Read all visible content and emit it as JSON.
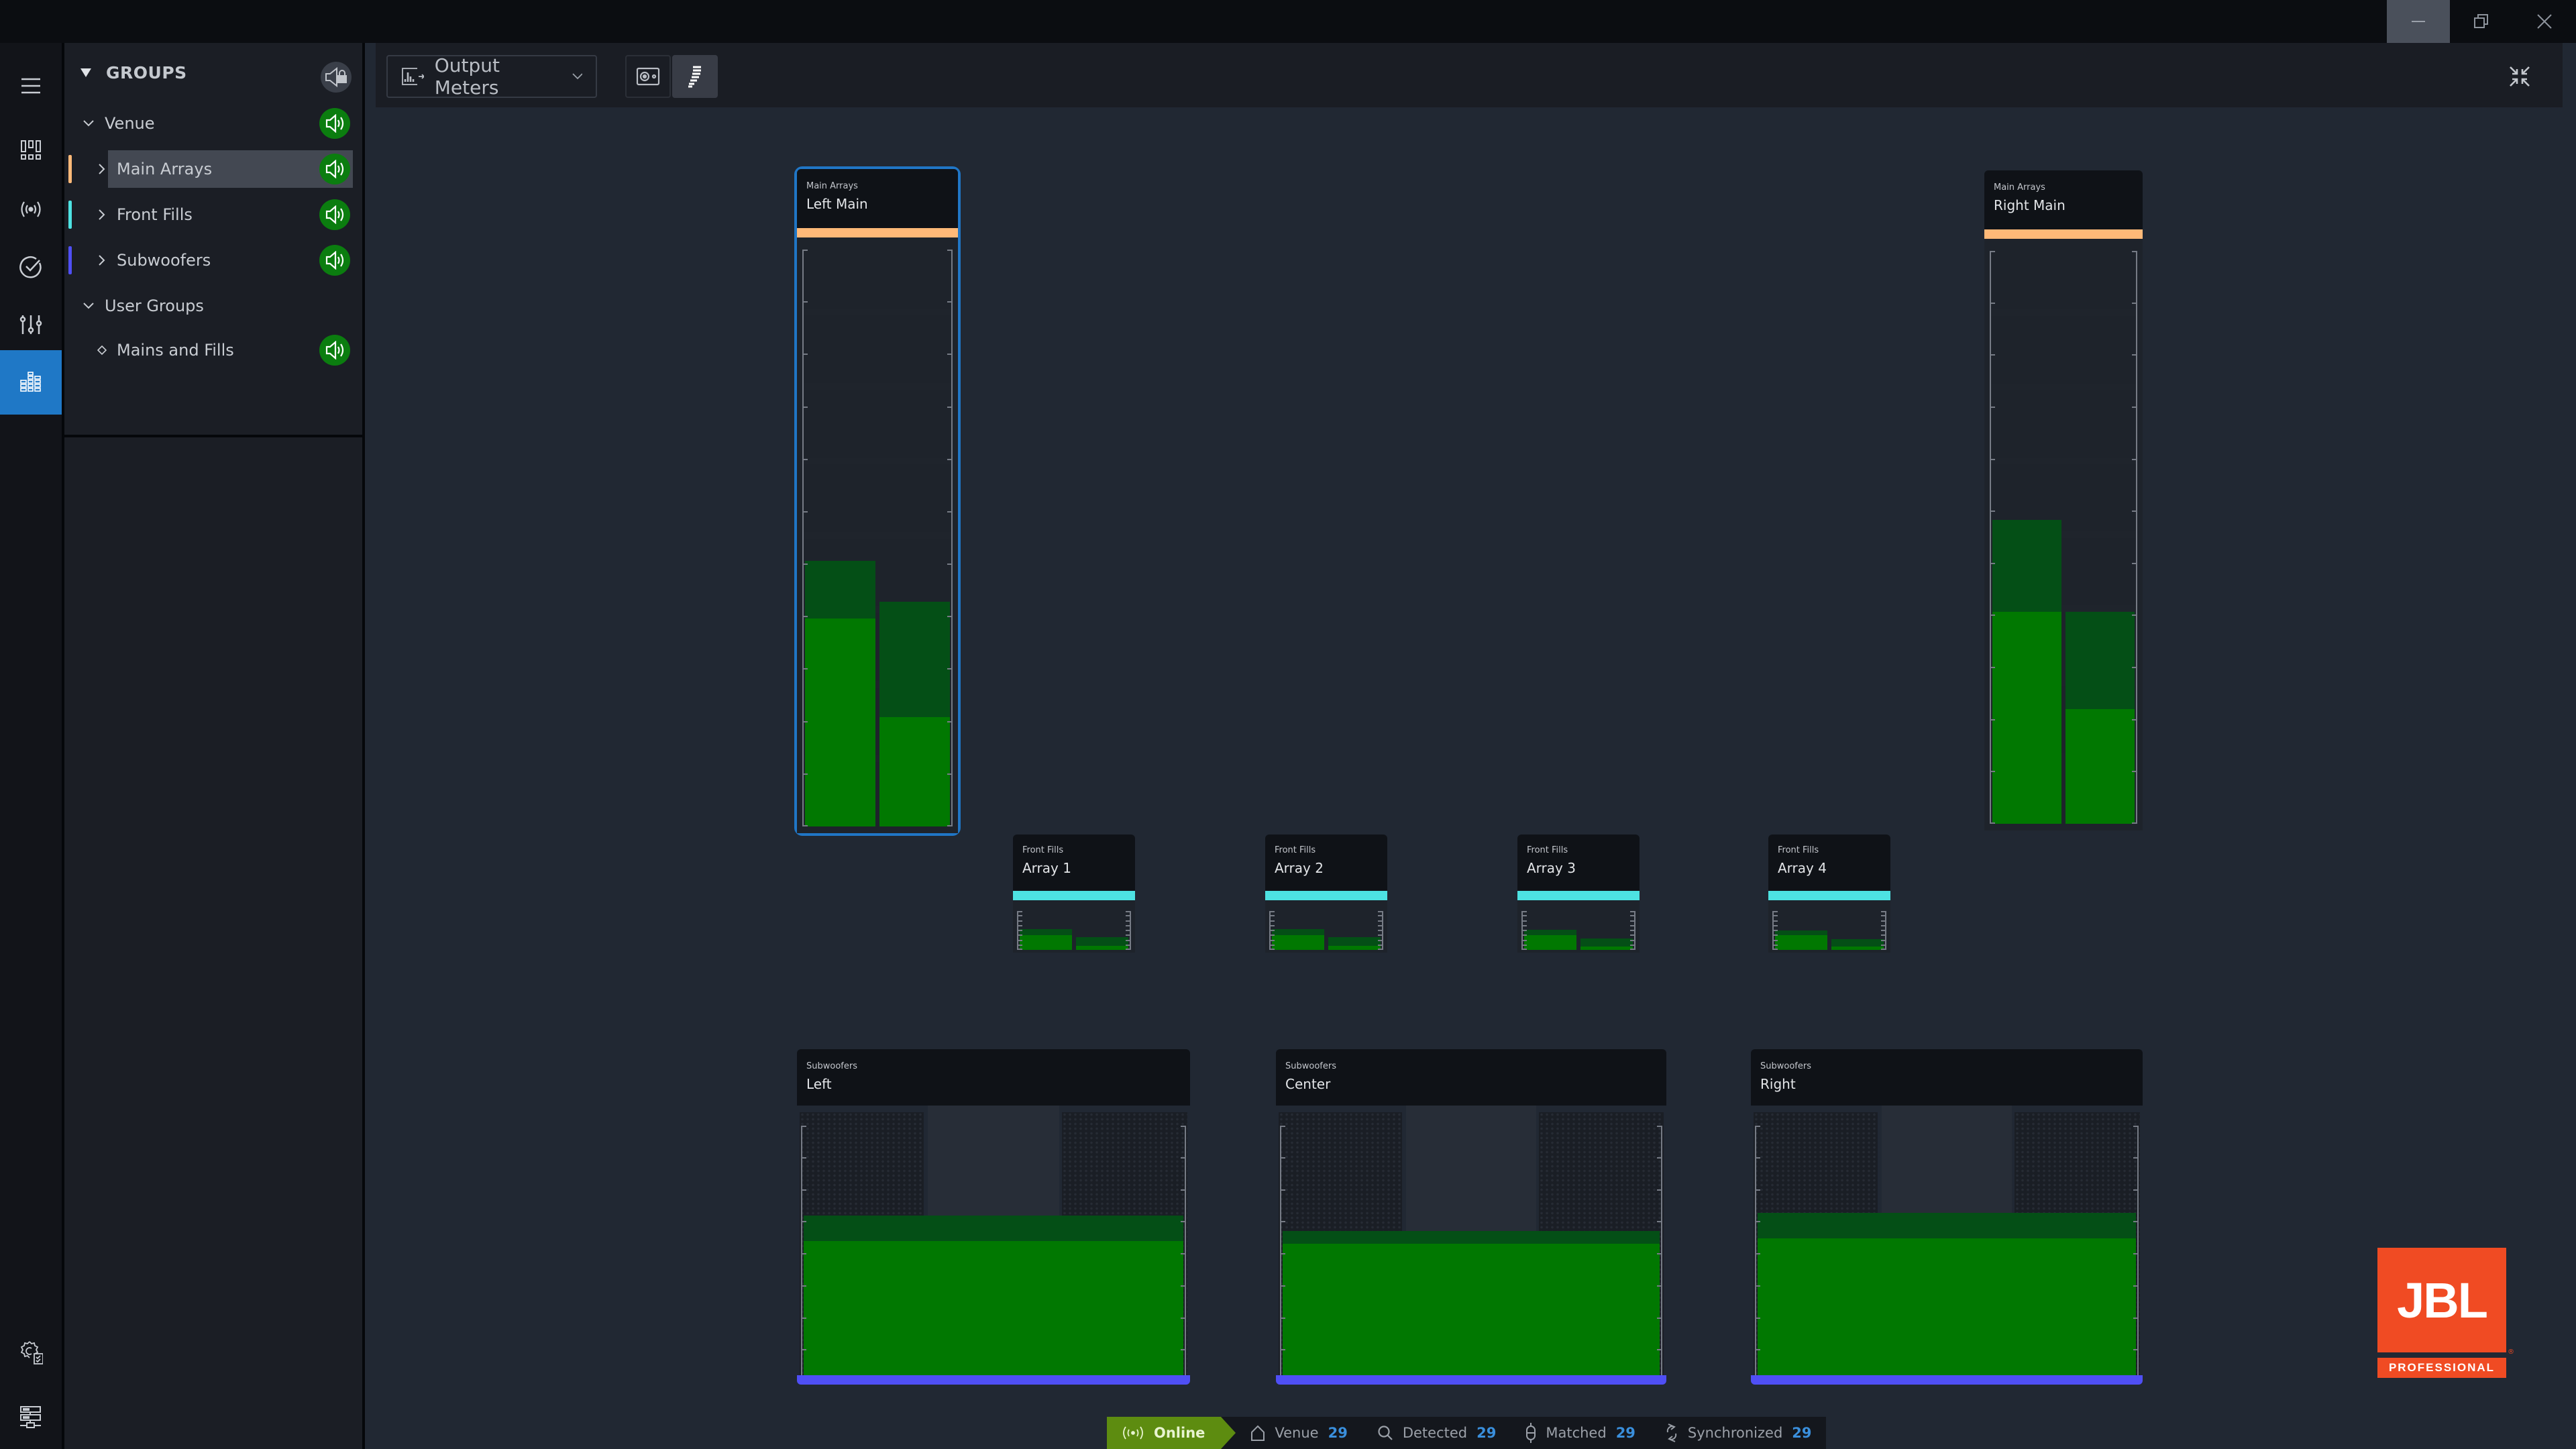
{
  "window": {
    "controls": {
      "minimize": "minimize",
      "restore": "restore",
      "close": "close"
    }
  },
  "rail": {
    "items": [
      {
        "name": "menu",
        "icon": "hamburger-icon",
        "active": false
      },
      {
        "name": "devices",
        "icon": "device-grid-icon",
        "active": false
      },
      {
        "name": "network",
        "icon": "broadcast-icon",
        "active": false
      },
      {
        "name": "check",
        "icon": "check-circle-icon",
        "active": false
      },
      {
        "name": "mixer",
        "icon": "sliders-icon",
        "active": false
      },
      {
        "name": "meters",
        "icon": "meter-bars-icon",
        "active": true
      },
      {
        "name": "settings",
        "icon": "gear-checklist-icon",
        "active": false
      },
      {
        "name": "server",
        "icon": "server-network-icon",
        "active": false
      }
    ]
  },
  "groups": {
    "title": "GROUPS",
    "lock_icon": "speaker-lock-icon",
    "items": [
      {
        "label": "Venue",
        "level": 0,
        "expander": "chevron-down",
        "has_mute": true,
        "color": null,
        "selected": false
      },
      {
        "label": "Main Arrays",
        "level": 1,
        "expander": "chevron-right",
        "has_mute": true,
        "color": "#ffb978",
        "selected": true
      },
      {
        "label": "Front Fills",
        "level": 1,
        "expander": "chevron-right",
        "has_mute": true,
        "color": "#4de2e2",
        "selected": false
      },
      {
        "label": "Subwoofers",
        "level": 1,
        "expander": "chevron-right",
        "has_mute": true,
        "color": "#4f4ff5",
        "selected": false
      },
      {
        "label": "User Groups",
        "level": 0,
        "expander": "chevron-down",
        "has_mute": false,
        "color": null,
        "selected": false
      },
      {
        "label": "Mains and Fills",
        "level": 1,
        "expander": "diamond",
        "has_mute": true,
        "color": null,
        "selected": false
      }
    ]
  },
  "toolbar": {
    "view_select": "Output Meters",
    "view_icon": "meter-output-icon",
    "buttons": [
      {
        "name": "speaker-view",
        "icon": "speaker-box-icon",
        "active": false
      },
      {
        "name": "array-view",
        "icon": "array-curve-icon",
        "active": true
      }
    ],
    "collapse_icon": "collapse-arrows-icon"
  },
  "colors": {
    "main_arrays": "#ffb978",
    "front_fills": "#4de2e2",
    "subwoofers": "#4f4ff5",
    "meter_rms": "#017801",
    "meter_peak": "#044f16",
    "selection": "#2076c6",
    "mute_on": "#0b7d0f",
    "online": "#5d8c10",
    "count": "#3a8fdc",
    "brand": "#f04b23"
  },
  "speakers": {
    "main": [
      {
        "group": "Main Arrays",
        "name": "Left Main",
        "selected": true,
        "segments": 8,
        "levels": [
          {
            "rms": 0.36,
            "peak": 0.46
          },
          {
            "rms": 0.19,
            "peak": 0.39
          }
        ]
      },
      {
        "group": "Main Arrays",
        "name": "Right Main",
        "selected": false,
        "segments": 8,
        "levels": [
          {
            "rms": 0.37,
            "peak": 0.53
          },
          {
            "rms": 0.2,
            "peak": 0.37
          }
        ]
      }
    ],
    "fills": [
      {
        "group": "Front Fills",
        "name": "Array 1",
        "levels": [
          {
            "rms": 0.38,
            "peak": 0.53
          },
          {
            "rms": 0.1,
            "peak": 0.32
          }
        ]
      },
      {
        "group": "Front Fills",
        "name": "Array 2",
        "levels": [
          {
            "rms": 0.38,
            "peak": 0.53
          },
          {
            "rms": 0.1,
            "peak": 0.32
          }
        ]
      },
      {
        "group": "Front Fills",
        "name": "Array 3",
        "levels": [
          {
            "rms": 0.38,
            "peak": 0.52
          },
          {
            "rms": 0.09,
            "peak": 0.29
          }
        ]
      },
      {
        "group": "Front Fills",
        "name": "Array 4",
        "levels": [
          {
            "rms": 0.38,
            "peak": 0.5
          },
          {
            "rms": 0.09,
            "peak": 0.27
          }
        ]
      }
    ],
    "subs": [
      {
        "group": "Subwoofers",
        "name": "Left",
        "levels": [
          {
            "rms": 0.55,
            "peak": 0.65
          }
        ]
      },
      {
        "group": "Subwoofers",
        "name": "Center",
        "levels": [
          {
            "rms": 0.54,
            "peak": 0.59
          }
        ]
      },
      {
        "group": "Subwoofers",
        "name": "Right",
        "levels": [
          {
            "rms": 0.56,
            "peak": 0.66
          }
        ]
      }
    ]
  },
  "status": {
    "online": "Online",
    "items": [
      {
        "label": "Venue",
        "value": "29",
        "icon": "home-icon"
      },
      {
        "label": "Detected",
        "value": "29",
        "icon": "search-icon"
      },
      {
        "label": "Matched",
        "value": "29",
        "icon": "match-icon"
      },
      {
        "label": "Synchronized",
        "value": "29",
        "icon": "sync-icon"
      }
    ]
  },
  "brand": {
    "logo_text": "JBL",
    "logo_sub": "PROFESSIONAL"
  }
}
